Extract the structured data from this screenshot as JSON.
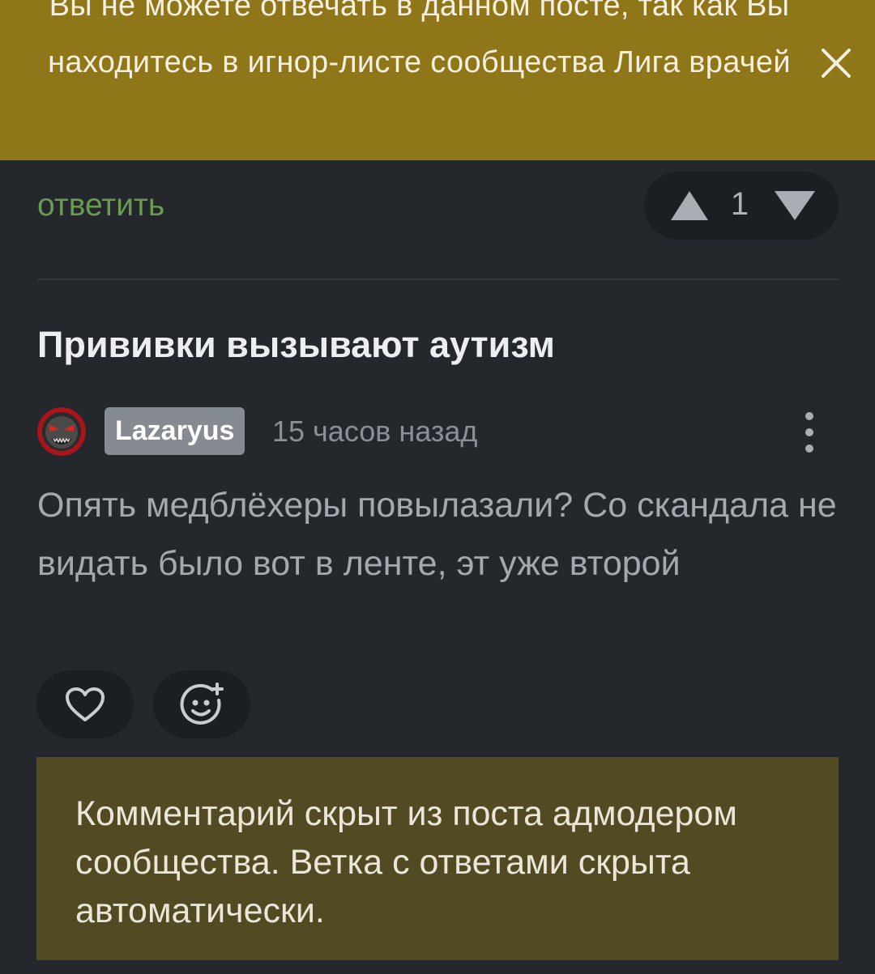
{
  "banner": {
    "message": "Вы не можете отвечать в данном посте, так как Вы находитесь в игнор-листе сообщества Лига врачей",
    "close_icon": "close-icon",
    "background": "#8f7619"
  },
  "reply": {
    "link_label": "ответить",
    "vote_count": "1",
    "upvote_icon": "triangle-up-icon",
    "downvote_icon": "triangle-down-icon"
  },
  "post": {
    "title": "Прививки вызывают аутизм"
  },
  "comment": {
    "author": "Lazaryus",
    "timestamp": "15 часов назад",
    "text": "Опять медблёхеры повылазали? Со скандала не видать было вот в ленте, эт уже второй",
    "menu_icon": "more-vertical-icon",
    "like_icon": "heart-icon",
    "reaction_icon": "add-reaction-icon"
  },
  "hidden_notice": {
    "text": "Комментарий скрыт из поста адмодером сообщества. Ветка с ответами скрыта автоматически.",
    "background": "#524a23"
  }
}
